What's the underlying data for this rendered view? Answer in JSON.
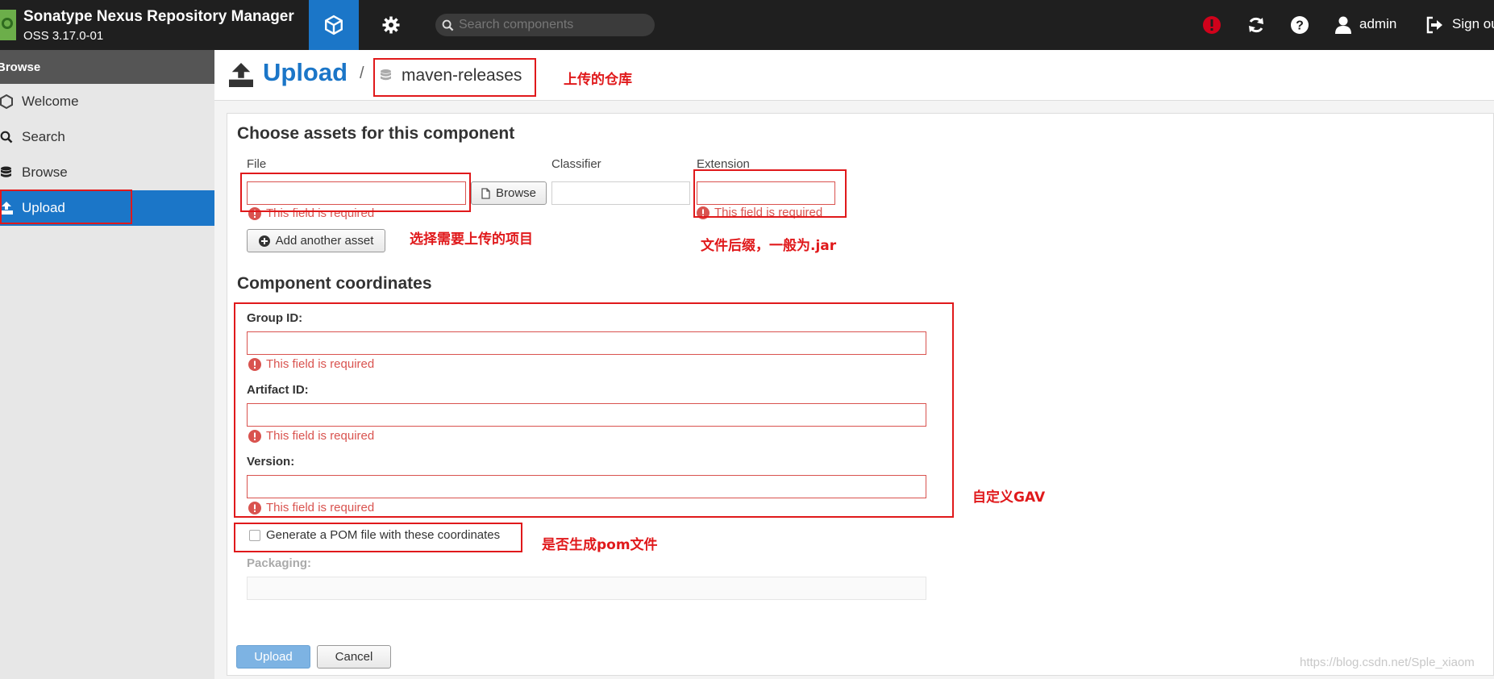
{
  "header": {
    "app_title": "Sonatype Nexus Repository Manager",
    "app_version": "OSS 3.17.0-01",
    "search_placeholder": "Search components",
    "user_name": "admin",
    "sign_out_label": "Sign out",
    "accent_color": "#1b76c8",
    "alert_color": "#d0021b"
  },
  "sidebar": {
    "header": "Browse",
    "items": [
      {
        "label": "Welcome",
        "icon": "hexagon-icon"
      },
      {
        "label": "Search",
        "icon": "search-icon"
      },
      {
        "label": "Browse",
        "icon": "database-icon"
      },
      {
        "label": "Upload",
        "icon": "upload-icon",
        "active": true
      }
    ]
  },
  "page": {
    "title": "Upload",
    "breadcrumb_sep": "/",
    "repository": "maven-releases"
  },
  "assets": {
    "section_title": "Choose assets for this component",
    "file_label": "File",
    "classifier_label": "Classifier",
    "extension_label": "Extension",
    "browse_button": "Browse",
    "file_error": "This field is required",
    "extension_error": "This field is required",
    "add_asset_button": "Add another asset"
  },
  "coordinates": {
    "section_title": "Component coordinates",
    "group_label": "Group ID:",
    "group_error": "This field is required",
    "artifact_label": "Artifact ID:",
    "artifact_error": "This field is required",
    "version_label": "Version:",
    "version_error": "This field is required",
    "generate_pom_label": "Generate a POM file with these coordinates",
    "generate_pom_checked": false,
    "packaging_label": "Packaging:"
  },
  "actions": {
    "upload_button": "Upload",
    "cancel_button": "Cancel"
  },
  "annotations": {
    "repo_note": "上传的仓库",
    "file_note": "选择需要上传的项目",
    "extension_note": "文件后缀，一般为.jar",
    "gav_note": "自定义GAV",
    "pom_note": "是否生成pom文件",
    "color": "#e0191b"
  },
  "watermark": "https://blog.csdn.net/Sple_xiaom"
}
